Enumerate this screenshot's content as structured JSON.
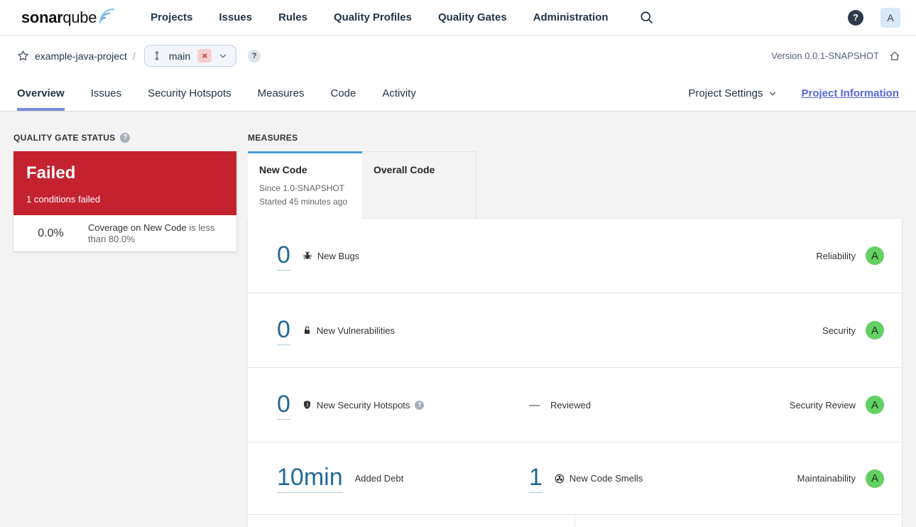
{
  "top_nav": {
    "logo_bold": "sonar",
    "logo_rest": "qube",
    "items": [
      "Projects",
      "Issues",
      "Rules",
      "Quality Profiles",
      "Quality Gates",
      "Administration"
    ],
    "help_glyph": "?",
    "avatar_initial": "A"
  },
  "context_bar": {
    "project_name": "example-java-project",
    "separator": "/",
    "branch": {
      "name": "main",
      "clear_glyph": "×"
    },
    "help_glyph": "?",
    "version_label": "Version 0.0.1-SNAPSHOT"
  },
  "tab_bar": {
    "tabs": [
      "Overview",
      "Issues",
      "Security Hotspots",
      "Measures",
      "Code",
      "Activity"
    ],
    "active_tab": "Overview",
    "project_settings_label": "Project Settings",
    "project_information_label": "Project Information"
  },
  "quality_gate": {
    "heading": "QUALITY GATE STATUS",
    "help_glyph": "?",
    "status": "Failed",
    "conditions_text": "1 conditions failed",
    "condition": {
      "value": "0.0%",
      "metric": "Coverage on New Code",
      "constraint": "is less than 80.0%"
    }
  },
  "measures": {
    "heading": "MEASURES",
    "tabs": [
      {
        "label": "New Code",
        "subtitle1": "Since 1.0-SNAPSHOT",
        "subtitle2": "Started 45 minutes ago"
      },
      {
        "label": "Overall Code"
      }
    ],
    "rows": [
      {
        "value": "0",
        "label": "New Bugs",
        "rating_label": "Reliability",
        "rating": "A"
      },
      {
        "value": "0",
        "label": "New Vulnerabilities",
        "rating_label": "Security",
        "rating": "A"
      },
      {
        "value": "0",
        "label": "New Security Hotspots",
        "help_glyph": "?",
        "reviewed_dash": "—",
        "reviewed_label": "Reviewed",
        "rating_label": "Security Review",
        "rating": "A"
      },
      {
        "value": "10min",
        "label": "Added Debt",
        "value2": "1",
        "label2": "New Code Smells",
        "rating_label": "Maintainability",
        "rating": "A"
      }
    ]
  },
  "colors": {
    "failed_red": "#c4222f",
    "rating_a_green": "#62d062",
    "metric_link_blue": "#236a97",
    "active_tab_underline": "#7b88dd",
    "new_code_tab_accent": "#4b9fd5",
    "project_information_link": "#5867dd"
  }
}
